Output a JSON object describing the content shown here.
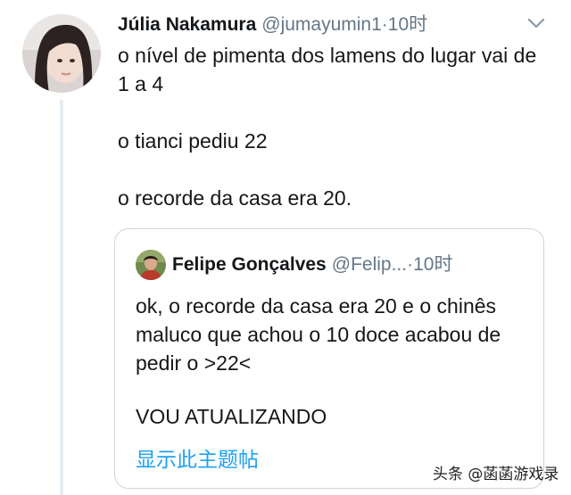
{
  "tweet": {
    "author_name": "Júlia Nakamura",
    "author_handle": "@jumayumin1",
    "separator": "·",
    "time": "10时",
    "lines": [
      "o nível de pimenta dos lamens do lugar vai de 1 a 4",
      "o tianci pediu 22",
      "o recorde da casa era 20."
    ]
  },
  "quoted_tweet": {
    "author_name": "Felipe Gonçalves",
    "author_handle": "@Felip...",
    "separator": "·",
    "time": "10时",
    "lines": [
      "ok, o recorde da casa era 20 e o chinês maluco que achou o 10 doce acabou de pedir o >22<",
      "VOU ATUALIZANDO"
    ],
    "show_thread_link": "显示此主题帖"
  },
  "watermark": "头条 @菡菡游戏录",
  "icons": {
    "author_avatar": "avatar-photo",
    "menu": "chevron-down-icon",
    "quoted_avatar": "avatar-photo"
  },
  "colors": {
    "primary_text": "#14171a",
    "secondary_text": "#657786",
    "link": "#1da1f2",
    "border": "#ccd6dd"
  }
}
